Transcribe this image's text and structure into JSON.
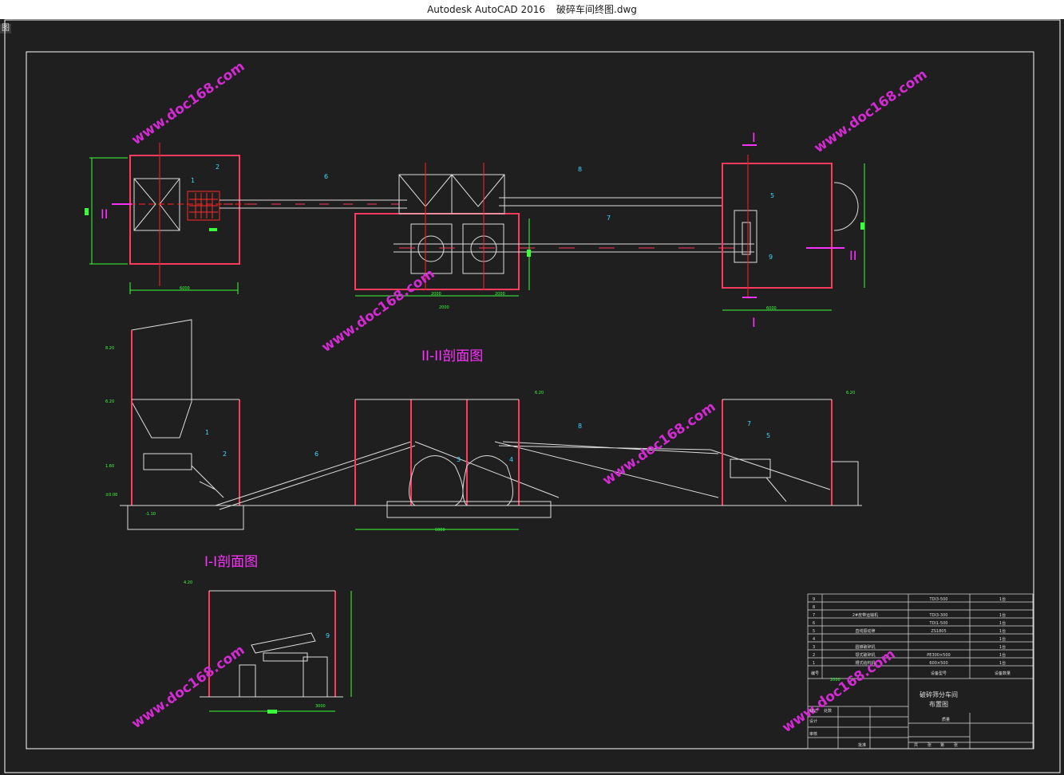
{
  "window": {
    "app_title": "Autodesk AutoCAD 2016",
    "file_name": "破碎车间终图.dwg",
    "corner_tag": "图"
  },
  "colors": {
    "background": "#1f1f1f",
    "frame": "#ffffff",
    "wall": "#ff3a5f",
    "dimension": "#39ff39",
    "leader": "#3ad8ff",
    "watermark": "#d42ad4",
    "centerline": "#ff2020",
    "section_label": "#ff33ff"
  },
  "watermark": "www.doc168.com",
  "sections": {
    "plan_left_mark": "II",
    "plan_right_mark": "II",
    "plan_top_mark": "I",
    "plan_bottom_mark": "I",
    "section_2_title": "II-II剖面图",
    "section_1_title": "I-I剖面图"
  },
  "plan_labels": [
    "1",
    "2",
    "6",
    "8",
    "7",
    "5",
    "9"
  ],
  "section2_labels": [
    "1",
    "2",
    "6",
    "3",
    "4",
    "8",
    "7",
    "5"
  ],
  "section1_labels": [
    "9"
  ],
  "elevations": [
    "8.20",
    "6.20",
    "1.60",
    "±0.00",
    "-1.10",
    "6.20",
    "6.20",
    "4.20"
  ],
  "dimensions": [
    "6000",
    "6000",
    "2000",
    "2000",
    "2000",
    "6000",
    "3000",
    "2000"
  ],
  "bom": {
    "rows": [
      {
        "no": "9",
        "name": "",
        "model": "TDI3-500",
        "qty": "1台"
      },
      {
        "no": "8",
        "name": "",
        "model": "",
        "qty": ""
      },
      {
        "no": "7",
        "name": "2#皮带运输机",
        "model": "TDI3-300",
        "qty": "1台"
      },
      {
        "no": "6",
        "name": "",
        "model": "TDI1-500",
        "qty": "1台"
      },
      {
        "no": "5",
        "name": "直线振动筛",
        "model": "ZS1805",
        "qty": "1台"
      },
      {
        "no": "4",
        "name": "",
        "model": "",
        "qty": "1台"
      },
      {
        "no": "3",
        "name": "圆锥破碎机",
        "model": "",
        "qty": "1台"
      },
      {
        "no": "2",
        "name": "颚式破碎机",
        "model": "PE300×500",
        "qty": "1台"
      },
      {
        "no": "1",
        "name": "槽式给料机",
        "model": "600×500",
        "qty": "1台"
      }
    ],
    "header": {
      "no": "编号",
      "name": "",
      "model": "设备型号",
      "qty": "设备数量"
    },
    "drawing_title": "破碎筛分车间 布置图",
    "side_labels": [
      "标记",
      "处数",
      "设计",
      "审核",
      "批准"
    ],
    "sheet_labels": [
      "共",
      "张",
      "第",
      "张"
    ],
    "weight_label": "质量"
  }
}
